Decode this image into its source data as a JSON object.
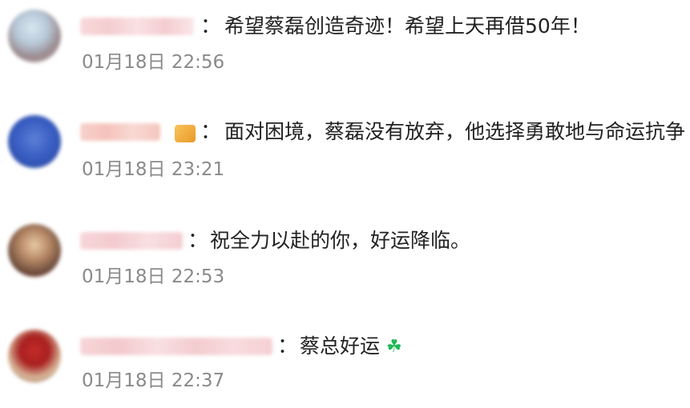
{
  "comments": [
    {
      "text": "希望蔡磊创造奇迹！希望上天再借50年！",
      "time": "01月18日 22:56",
      "separator": "："
    },
    {
      "text": "面对困境，蔡磊没有放弃，他选择勇敢地与命运抗争",
      "time": "01月18日 23:21",
      "separator": "："
    },
    {
      "text": "祝全力以赴的你，好运降临。",
      "time": "01月18日 22:53",
      "separator": "："
    },
    {
      "text": "蔡总好运",
      "time": "01月18日 22:37",
      "separator": "：",
      "emoji": "☘"
    }
  ],
  "colors": {
    "text": "#222222",
    "timestamp": "#8a8a8a",
    "clover": "#1db954"
  }
}
